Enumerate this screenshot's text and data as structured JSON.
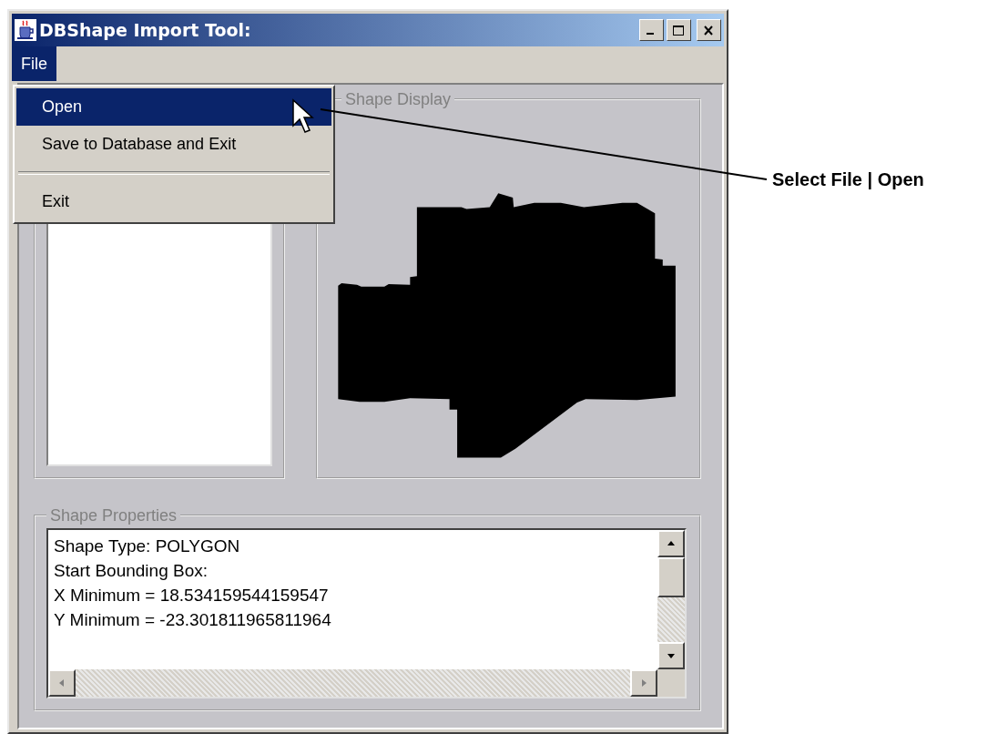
{
  "window": {
    "title": "DBShape Import Tool:"
  },
  "menu_bar": [
    {
      "label": "File",
      "selected": true
    }
  ],
  "menu": {
    "items": [
      {
        "kind": "item",
        "label": "Open",
        "selected": true
      },
      {
        "kind": "item",
        "label": "Save to Database and Exit",
        "selected": false
      },
      {
        "kind": "separator"
      },
      {
        "kind": "item",
        "label": "Exit",
        "selected": false
      }
    ]
  },
  "shape_display": {
    "title": "Shape Display"
  },
  "shape_properties": {
    "title": "Shape Properties",
    "lines": [
      "Shape Type: POLYGON",
      "Start Bounding Box:",
      "X Minimum = 18.534159544159547",
      "Y Minimum = -23.301811965811964"
    ]
  },
  "annotation": {
    "text": "Select File | Open"
  }
}
